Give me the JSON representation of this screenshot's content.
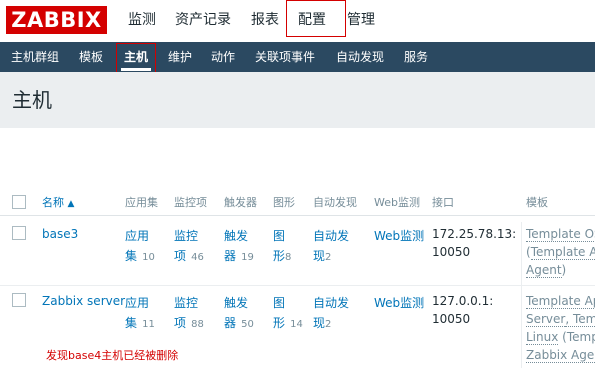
{
  "logo": "ZABBIX",
  "top_menu": [
    "监测",
    "资产记录",
    "报表",
    "配置",
    "管理"
  ],
  "sub_menu": [
    "主机群组",
    "模板",
    "主机",
    "维护",
    "动作",
    "关联项事件",
    "自动发现",
    "服务"
  ],
  "page_title": "主机",
  "table": {
    "headers": [
      "名称",
      "应用集",
      "监控项",
      "触发器",
      "图形",
      "自动发现",
      "Web监测",
      "接口",
      "模板"
    ],
    "sort_arrow": "▲",
    "rows": [
      {
        "name": "base3",
        "apps_l1": "应用",
        "apps_l2": "集",
        "apps_count": "10",
        "items_l1": "监控",
        "items_l2": "项",
        "items_count": "46",
        "triggers_l1": "触发",
        "triggers_l2": "器",
        "triggers_count": "19",
        "graphs_l1": "图",
        "graphs_l2": "形",
        "graphs_count": "8",
        "discovery_l1": "自动发",
        "discovery_l2": "现",
        "discovery_count": "2",
        "web": "Web监测",
        "interface_l1": "172.25.78.13:",
        "interface_l2": "10050",
        "tpl_l1": "Template OS",
        "tpl_l2_prefix": "(",
        "tpl_l2": "Template Ap",
        "tpl_l3": "Agent",
        "tpl_l3_suffix": ")"
      },
      {
        "name": "Zabbix server",
        "apps_l1": "应用",
        "apps_l2": "集",
        "apps_count": "11",
        "items_l1": "监控",
        "items_l2": "项",
        "items_count": "88",
        "triggers_l1": "触发",
        "triggers_l2": "器",
        "triggers_count": "50",
        "graphs_l1": "图",
        "graphs_l2": "形",
        "graphs_count": "14",
        "discovery_l1": "自动发",
        "discovery_l2": "现",
        "discovery_count": "2",
        "web": "Web监测",
        "interface_l1": "127.0.0.1:",
        "interface_l2": "10050",
        "tpl_l1": "Template Ap",
        "tpl_l2": "Server",
        "tpl_l2_suffix": ", Temp",
        "tpl_l3": "Linux",
        "tpl_l3_suffix": " (Temp",
        "tpl_l4": "Zabbix Agent"
      }
    ]
  },
  "note": "发现base4主机已经被删除",
  "colors": {
    "brand": "#d40000",
    "nav": "#2b4961",
    "link": "#0275b8",
    "header_bg": "#ebeef0"
  }
}
